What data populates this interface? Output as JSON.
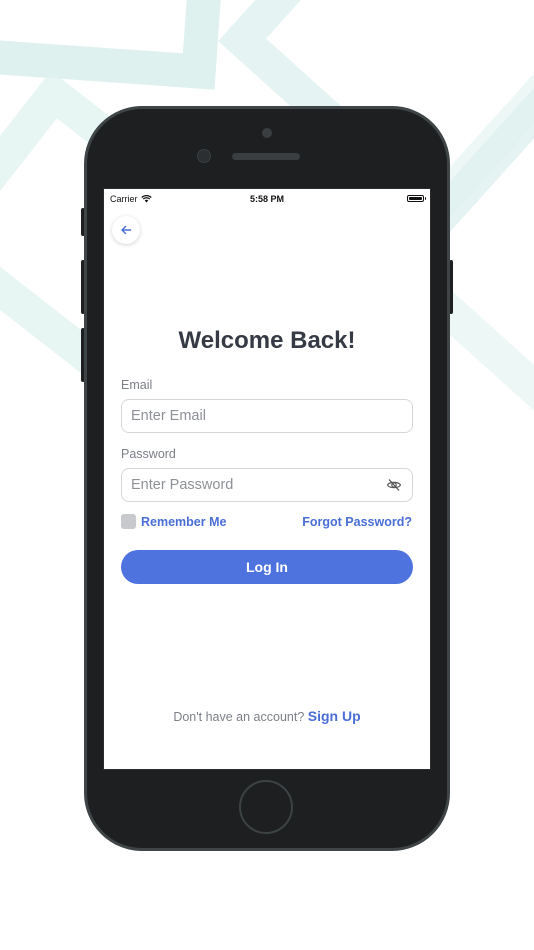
{
  "status_bar": {
    "carrier": "Carrier",
    "time": "5:58 PM"
  },
  "header": {
    "back_icon": "arrow-left-icon"
  },
  "main": {
    "title": "Welcome Back!",
    "email": {
      "label": "Email",
      "placeholder": "Enter Email",
      "value": ""
    },
    "password": {
      "label": "Password",
      "placeholder": "Enter Password",
      "value": "",
      "toggle_icon": "eye-off-icon"
    },
    "remember_me": {
      "label": "Remember Me",
      "checked": false
    },
    "forgot_password": "Forgot Password?",
    "login_button": "Log In",
    "signup_prompt": "Don't have an account?",
    "signup_link": "Sign Up"
  },
  "colors": {
    "accent": "#4e73df",
    "link": "#4a6ed6",
    "background_pattern": "#dff1ef",
    "device": "#1d1f20"
  }
}
